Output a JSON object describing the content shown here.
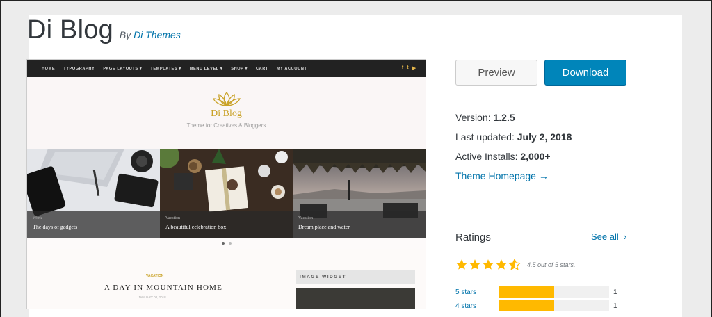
{
  "theme": {
    "name": "Di Blog",
    "by_label": "By",
    "author": "Di Themes"
  },
  "preview": {
    "nav": [
      "HOME",
      "TYPOGRAPHY",
      "PAGE LAYOUTS ▾",
      "TEMPLATES ▾",
      "MENU LEVEL ▾",
      "SHOP ▾",
      "CART",
      "MY ACCOUNT"
    ],
    "social": [
      "f",
      "t",
      "▶"
    ],
    "site_title": "Di Blog",
    "tagline": "Theme for Creatives & Bloggers",
    "slides": [
      {
        "category": "Work",
        "title": "The days of gadgets"
      },
      {
        "category": "Vacation",
        "title": "A beautiful celebration box"
      },
      {
        "category": "Vacation",
        "title": "Dream place and water"
      }
    ],
    "post_category": "VACATION",
    "post_title": "A DAY IN MOUNTAIN HOME",
    "post_date": "JANUARY 08, 2018",
    "widget_title": "IMAGE WIDGET"
  },
  "actions": {
    "preview_label": "Preview",
    "download_label": "Download"
  },
  "meta": {
    "version_label": "Version:",
    "version": "1.2.5",
    "updated_label": "Last updated:",
    "updated": "July 2, 2018",
    "installs_label": "Active Installs:",
    "installs": "2,000+",
    "homepage_link": "Theme Homepage →"
  },
  "ratings": {
    "title": "Ratings",
    "see_all": "See all",
    "stars_value": 4.5,
    "summary": "4.5 out of 5 stars.",
    "bars": [
      {
        "label": "5 stars",
        "fraction": 0.5,
        "count": "1"
      },
      {
        "label": "4 stars",
        "fraction": 0.5,
        "count": "1"
      }
    ]
  },
  "colors": {
    "accent": "#0085ba",
    "link": "#0073aa",
    "star": "#ffb900"
  }
}
